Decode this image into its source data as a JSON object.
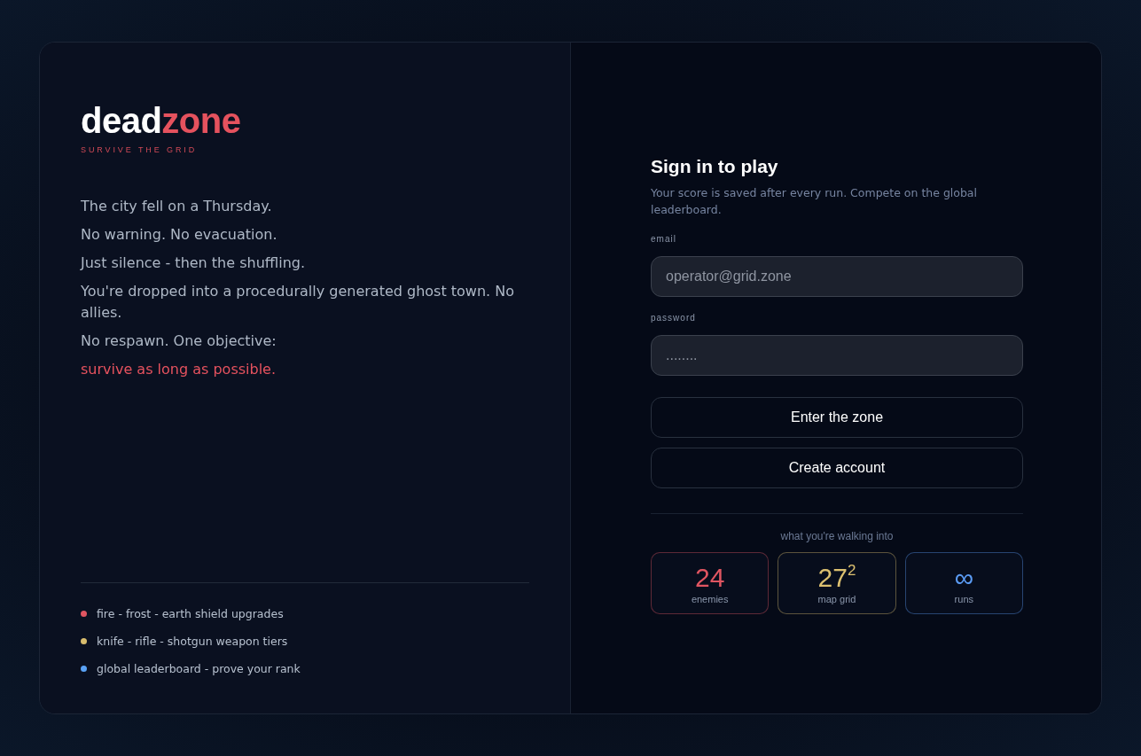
{
  "logo": {
    "primary": "dead",
    "accent": "zone",
    "tagline": "SURVIVE THE GRID"
  },
  "story": [
    {
      "text": "The city fell on a Thursday.",
      "highlight": false
    },
    {
      "text": "No warning. No evacuation.",
      "highlight": false
    },
    {
      "text": "Just silence - then the shuffling.",
      "highlight": false
    },
    {
      "text": "You're dropped into a procedurally generated ghost town. No allies.",
      "highlight": false
    },
    {
      "text": "No respawn. One objective:",
      "highlight": false
    },
    {
      "text": "survive as long as possible.",
      "highlight": true
    }
  ],
  "features": [
    {
      "text": "fire - frost - earth shield upgrades",
      "color": "#e05561"
    },
    {
      "text": "knife - rifle - shotgun weapon tiers",
      "color": "#d9bd6e"
    },
    {
      "text": "global leaderboard - prove your rank",
      "color": "#5aa2f5"
    }
  ],
  "sign_in": {
    "title": "Sign in to play",
    "subtitle": "Your score is saved after every run. Compete on the global leaderboard.",
    "fields": [
      {
        "label": "email",
        "placeholder": "operator@grid.zone"
      },
      {
        "label": "password",
        "placeholder": "........"
      }
    ],
    "buttons": [
      "Enter the zone",
      "Create account"
    ],
    "stats_caption": "what you're walking into",
    "stats": [
      {
        "value": "24",
        "label": "enemies",
        "color": "#e05561"
      },
      {
        "value": "27$^{2}$",
        "label": "map grid",
        "color": "#dcc070"
      },
      {
        "value": "∞",
        "label": "runs",
        "color": "#5b9cf5"
      }
    ]
  }
}
